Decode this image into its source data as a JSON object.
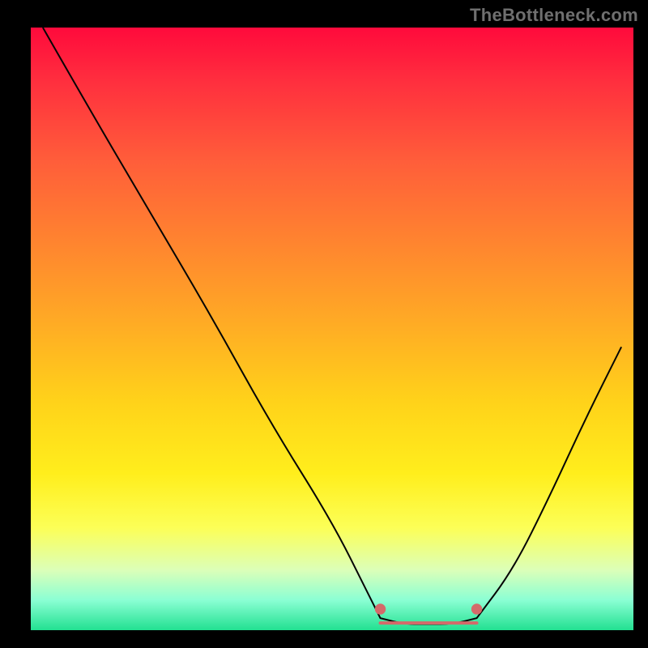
{
  "watermark": "TheBottleneck.com",
  "chart_data": {
    "type": "line",
    "title": "",
    "xlabel": "",
    "ylabel": "",
    "xlim": [
      0,
      100
    ],
    "ylim": [
      0,
      100
    ],
    "notes": "Bottleneck-percentage style V-curve over a red-to-green vertical gradient. No numeric axis ticks visible; values are estimated from pixel positions (0–100 normalized).",
    "series": [
      {
        "name": "left-branch",
        "x": [
          2,
          10,
          20,
          30,
          40,
          50,
          56,
          58
        ],
        "y": [
          100,
          86,
          69,
          52,
          34,
          18,
          6,
          2
        ]
      },
      {
        "name": "valley",
        "x": [
          58,
          62,
          66,
          70,
          74
        ],
        "y": [
          2,
          1,
          1,
          1,
          2
        ]
      },
      {
        "name": "right-branch",
        "x": [
          74,
          80,
          86,
          92,
          98
        ],
        "y": [
          2,
          10,
          22,
          35,
          47
        ]
      }
    ],
    "markers": [
      {
        "name": "range-start-dot",
        "x": 58,
        "y": 3.5
      },
      {
        "name": "range-end-dot",
        "x": 74,
        "y": 3.5
      }
    ],
    "optimal_range": {
      "x_start": 58,
      "x_end": 74
    },
    "colors": {
      "curve": "#050505",
      "marker": "#d46a6a",
      "range": "#d46a6a"
    }
  }
}
